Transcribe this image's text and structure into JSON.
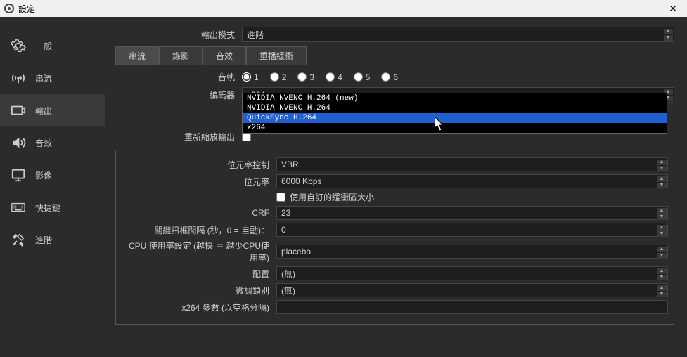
{
  "titlebar": {
    "title": "設定"
  },
  "sidebar": {
    "items": [
      {
        "label": "一般"
      },
      {
        "label": "串流"
      },
      {
        "label": "輸出"
      },
      {
        "label": "音效"
      },
      {
        "label": "影像"
      },
      {
        "label": "快捷鍵"
      },
      {
        "label": "進階"
      }
    ]
  },
  "outputMode": {
    "label": "輸出模式",
    "value": "進階"
  },
  "tabs": [
    {
      "label": "串流"
    },
    {
      "label": "錄影"
    },
    {
      "label": "音效"
    },
    {
      "label": "重播緩衝"
    }
  ],
  "audioTracks": {
    "label": "音軌",
    "options": [
      "1",
      "2",
      "3",
      "4",
      "5",
      "6"
    ]
  },
  "encoder": {
    "label": "編碼器",
    "value": "x264",
    "options": [
      "NVIDIA NVENC H.264 (new)",
      "NVIDIA NVENC H.264",
      "QuickSync H.264",
      "x264"
    ]
  },
  "rescale": {
    "label": "重新縮放輸出"
  },
  "panel": {
    "rateControl": {
      "label": "位元率控制",
      "value": "VBR"
    },
    "bitrate": {
      "label": "位元率",
      "value": "6000 Kbps"
    },
    "customBuffer": {
      "label": "使用自訂的緩衝區大小"
    },
    "crf": {
      "label": "CRF",
      "value": "23"
    },
    "keyframe": {
      "label": "關鍵訊框間隔 (秒，0 = 自動)：",
      "value": "0"
    },
    "cpuPreset": {
      "label": "CPU 使用率設定 (越快 ＝ 越少CPU使用率)",
      "value": "placebo"
    },
    "profile": {
      "label": "配置",
      "value": "(無)"
    },
    "tune": {
      "label": "微調類別",
      "value": "(無)"
    },
    "x264opts": {
      "label": "x264 參數 (以空格分隔)",
      "value": ""
    }
  }
}
